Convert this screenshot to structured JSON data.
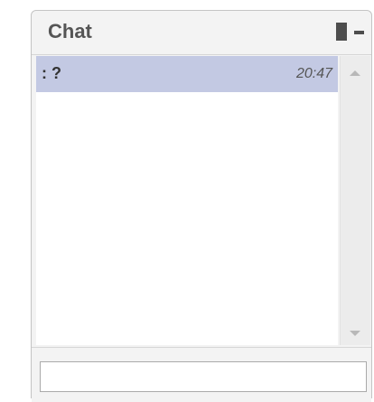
{
  "window": {
    "title": "Chat",
    "icons": {
      "maximize": "maximize-icon",
      "minimize": "minimize-icon"
    }
  },
  "messages": [
    {
      "text": ": ?",
      "time": "20:47"
    }
  ],
  "scrollbar": {
    "up_icon": "scroll-up-icon",
    "down_icon": "scroll-down-icon"
  },
  "input": {
    "value": "",
    "placeholder": ""
  },
  "colors": {
    "selected_row": "#c3c9e3",
    "panel_bg": "#f3f3f3",
    "icon": "#4d4d4d"
  }
}
